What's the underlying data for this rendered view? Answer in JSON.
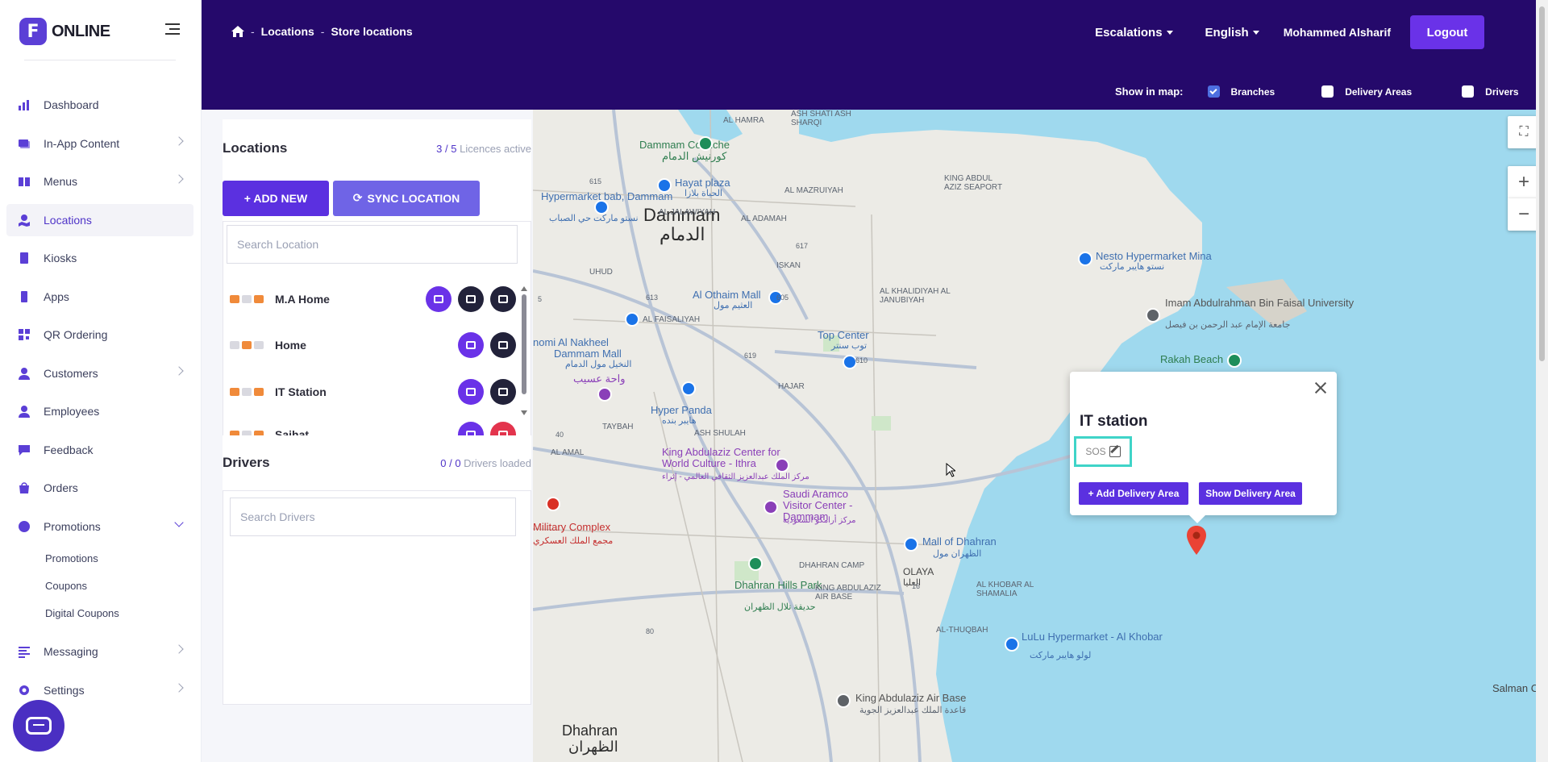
{
  "brand": {
    "logo_letter": "F",
    "name": "ONLINE"
  },
  "sidebar": {
    "items": [
      {
        "label": "Dashboard",
        "icon": "chart-bar-icon",
        "has_chevron": false
      },
      {
        "label": "In-App Content",
        "icon": "images-icon",
        "has_chevron": true
      },
      {
        "label": "Menus",
        "icon": "book-icon",
        "has_chevron": true
      },
      {
        "label": "Locations",
        "icon": "map-marked-icon",
        "has_chevron": false,
        "active": true
      },
      {
        "label": "Kiosks",
        "icon": "tablet-icon",
        "has_chevron": false
      },
      {
        "label": "Apps",
        "icon": "mobile-icon",
        "has_chevron": false
      },
      {
        "label": "QR Ordering",
        "icon": "qrcode-icon",
        "has_chevron": false
      },
      {
        "label": "Customers",
        "icon": "user-icon",
        "has_chevron": true
      },
      {
        "label": "Employees",
        "icon": "user-tie-icon",
        "has_chevron": false
      },
      {
        "label": "Feedback",
        "icon": "comment-icon",
        "has_chevron": false
      },
      {
        "label": "Orders",
        "icon": "shopping-bag-icon",
        "has_chevron": false
      },
      {
        "label": "Promotions",
        "icon": "percent-icon",
        "has_chevron": true,
        "expanded": true
      }
    ],
    "promotions_sub": [
      "Promotions",
      "Coupons",
      "Digital Coupons"
    ],
    "bottom_items": [
      {
        "label": "Messaging",
        "icon": "align-left-icon"
      },
      {
        "label": "Settings",
        "icon": "gear-icon"
      }
    ]
  },
  "header": {
    "breadcrumb": [
      "Locations",
      "Store locations"
    ],
    "escalations": "Escalations",
    "language": "English",
    "user": "Mohammed Alsharif",
    "logout": "Logout",
    "show_in_map": "Show in map:",
    "filters": [
      {
        "label": "Branches",
        "checked": true
      },
      {
        "label": "Delivery Areas",
        "checked": false
      },
      {
        "label": "Drivers",
        "checked": false
      }
    ]
  },
  "locations": {
    "title": "Locations",
    "licences_active": "3",
    "licences_total": "5",
    "licences_text": "Licences active",
    "add_new": "+ ADD NEW",
    "sync": "SYNC LOCATION",
    "search_placeholder": "Search Location",
    "rows": [
      {
        "name": "M.A Home",
        "actions": [
          "edit",
          "store",
          "map"
        ]
      },
      {
        "name": "Home",
        "actions": [
          "edit",
          "store"
        ]
      },
      {
        "name": "IT Station",
        "actions": [
          "edit",
          "store"
        ]
      },
      {
        "name": "Saihat",
        "actions": [
          "edit",
          "delete"
        ]
      }
    ]
  },
  "drivers": {
    "title": "Drivers",
    "loaded": "0",
    "total": "0",
    "loaded_text": "Drivers loaded",
    "search_placeholder": "Search Drivers"
  },
  "map": {
    "labels": {
      "dammam_en": "Dammam",
      "dammam_ar": "الدمام",
      "dhahran_en": "Dhahran",
      "dhahran_ar": "الظهران",
      "corniche": "Dammam Corniche",
      "corniche_ar": "كورنيش الدمام",
      "hayat_plaza": "Hayat plaza",
      "hayat_ar": "الحياة بلازا",
      "nesto": "Nesto Hypermarket Mina",
      "nesto_ar": "نستو هايبر ماركت",
      "othaim": "Al Othaim Mall",
      "othaim_ar": "العثيم مول",
      "imam_university": "Imam Abdulrahman Bin Faisal University",
      "imam_ar": "جامعة الإمام عبد الرحمن بن فيصل",
      "top_center": "Top Center",
      "top_center_ar": "توب سنتر",
      "rakah_beach": "Rakah Beach",
      "hyper_panda": "Hyper Panda",
      "hyper_panda_ar": "هايبر بنده",
      "nakheel_mall": "Al Nakheel Dammam Mall",
      "nakheel_ar": "النخيل مول الدمام",
      "ithra": "King Abdulaziz Center for World Culture - Ithra",
      "ithra_ar": "مركز الملك عبدالعزيز الثقافي العالمي - إثراء",
      "aramco_center": "Saudi Aramco Visitor Center - Dammam",
      "aramco_ar": "مركز أرامكو السعودية",
      "military_complex": "Military Complex",
      "military_ar": "مجمع الملك العسكري",
      "mall_of_dhahran": "Mall of Dhahran",
      "mall_of_dhahran_ar": "الظهران مول",
      "dhahran_hills": "Dhahran Hills Park",
      "dhahran_hills_ar": "حديقة تلال الظهران",
      "olaya": "OLAYA",
      "olaya_ar": "العليا",
      "lulu": "LuLu Hypermarket - Al Khobar",
      "lulu_ar": "لولو هايبر ماركت",
      "airbase": "King Abdulaziz Air Base",
      "airbase_ar": "قاعدة الملك عبدالعزيز الجوية",
      "salman_city": "Salman City",
      "waha": "واحة عسيب",
      "dhahran_camp": "DHAHRAN CAMP",
      "al_khobar_shamalia": "AL KHOBAR AL SHAMALIA",
      "al_hamra": "AL HAMRA",
      "ash_sharqi": "ASH SHATI ASH SHARQI",
      "al_mazruiyah": "AL MAZRUIYAH",
      "al_jalawiyah": "AL JALAWIYAH",
      "al_adamah": "AL ADAMAH",
      "al_faisaliyah": "AL FAISALIYAH",
      "hajar": "HAJAR",
      "ash_shulah": "ASH SHULAH",
      "taybah": "TAYBAH",
      "al_amal": "AL AMAL",
      "uhud": "UHUD",
      "al_thuqbah": "AL-THUQBAH",
      "king_abdulaziz_airbase_dist": "KING ABDULAZIZ AIR BASE",
      "al_khalidiyah": "AL KHALIDIYAH AL JANUBIYAH",
      "seaport": "KING ABDUL AZIZ SEAPORT",
      "iskan": "ISKAN",
      "hypermarket_left": "Hypermarket bab, Dammam",
      "hypermarket_left_ar": "نستو ماركت حي الصباب",
      "nakheel_prefix": "nomi Al Nakheel",
      "nakheel_prefix2": "Dammam Mall",
      "road_615": "615",
      "road_617": "617",
      "road_613": "613",
      "road_605": "605",
      "road_619": "619",
      "road_610": "610",
      "road_80": "80",
      "road_40": "40",
      "road_16": "16",
      "road_5": "5"
    }
  },
  "popup": {
    "title": "IT station",
    "sos": "SOS",
    "add_delivery": "+ Add Delivery Area",
    "show_delivery": "Show Delivery Area"
  },
  "colors": {
    "header_bg": "#25096b",
    "accent": "#5b30e0",
    "sidebar_icon": "#5b3fd6",
    "sea": "#9fd9ee"
  }
}
